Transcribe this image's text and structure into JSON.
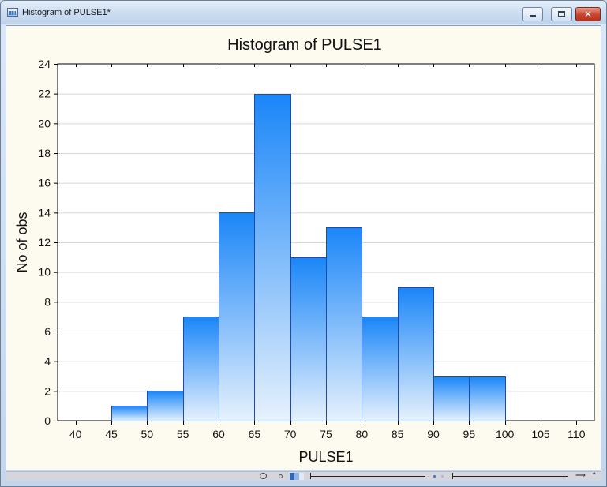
{
  "window": {
    "title": "Histogram of PULSE1*",
    "controls": {
      "minimize_icon": "minimize-icon",
      "maximize_icon": "maximize-icon",
      "close_icon": "close-icon",
      "close_glyph": "✕"
    },
    "app_icon": "histogram-app-icon"
  },
  "colors": {
    "bar_top": "#1a86f8",
    "bar_bottom": "#e6f1fd",
    "bar_stroke": "#1d49b0",
    "plot_bg": "#ffffff",
    "panel_bg": "#fdfaf0",
    "grid": "#d7d7d7"
  },
  "chart_data": {
    "type": "bar",
    "title": "Histogram of PULSE1",
    "xlabel": "PULSE1",
    "ylabel": "No of obs",
    "bin_edges": [
      45,
      50,
      55,
      60,
      65,
      70,
      75,
      80,
      85,
      90,
      95,
      100
    ],
    "values": [
      1,
      2,
      7,
      14,
      22,
      11,
      13,
      7,
      9,
      3,
      3
    ],
    "xlim": [
      37.5,
      112.5
    ],
    "ylim": [
      0,
      24
    ],
    "xticks": [
      40,
      45,
      50,
      55,
      60,
      65,
      70,
      75,
      80,
      85,
      90,
      95,
      100,
      105,
      110
    ],
    "yticks": [
      0,
      2,
      4,
      6,
      8,
      10,
      12,
      14,
      16,
      18,
      20,
      22,
      24
    ],
    "grid": true,
    "legend": "none"
  }
}
